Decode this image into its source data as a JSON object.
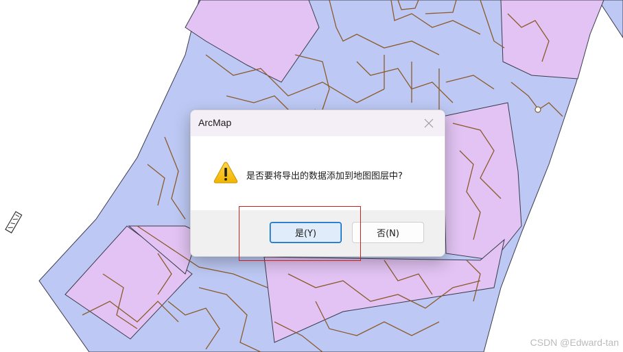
{
  "background": {
    "colors": {
      "blue_zone": "#bdc9f4",
      "purple_zone": "#e2c3f3",
      "road": "#8b5a2b",
      "border": "#3a3a4a"
    }
  },
  "dialog": {
    "title": "ArcMap",
    "message": "是否要将导出的数据添加到地图图层中?",
    "yes_label": "是(Y)",
    "no_label": "否(N)",
    "icon": "warning-icon",
    "close_icon": "close-icon"
  },
  "annotation": {
    "color": "#cc2020"
  },
  "watermark": "CSDN @Edward-tan"
}
